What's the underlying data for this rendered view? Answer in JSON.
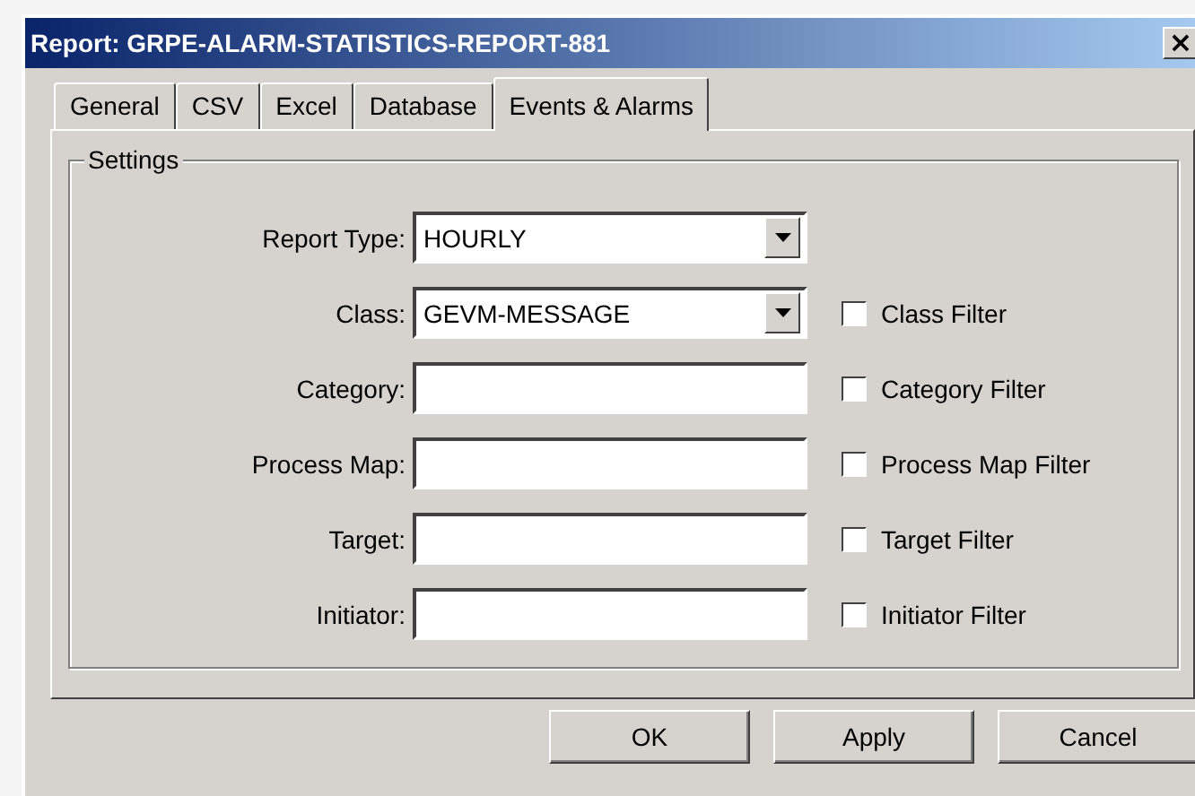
{
  "window": {
    "title": "Report: GRPE-ALARM-STATISTICS-REPORT-881",
    "close": "×"
  },
  "tabs": [
    {
      "label": "General",
      "selected": false
    },
    {
      "label": "CSV",
      "selected": false
    },
    {
      "label": "Excel",
      "selected": false
    },
    {
      "label": "Database",
      "selected": false
    },
    {
      "label": "Events & Alarms",
      "selected": true
    }
  ],
  "group": {
    "title": "Settings"
  },
  "rows": [
    {
      "kind": "dropdown",
      "label": "Report Type:",
      "value": "HOURLY"
    },
    {
      "kind": "dropdown",
      "label": "Class:",
      "value": "GEVM-MESSAGE",
      "filter": {
        "label": "Class Filter",
        "checked": false
      }
    },
    {
      "kind": "text",
      "label": "Category:",
      "filter": {
        "label": "Category Filter",
        "checked": false
      }
    },
    {
      "kind": "text",
      "label": "Process Map:",
      "filter": {
        "label": "Process Map Filter",
        "checked": false
      }
    },
    {
      "kind": "text",
      "label": "Target:",
      "filter": {
        "label": "Target Filter",
        "checked": false
      }
    },
    {
      "kind": "text",
      "label": "Initiator:",
      "filter": {
        "label": "Initiator Filter",
        "checked": false
      }
    }
  ],
  "buttons": [
    "OK",
    "Apply",
    "Cancel"
  ]
}
